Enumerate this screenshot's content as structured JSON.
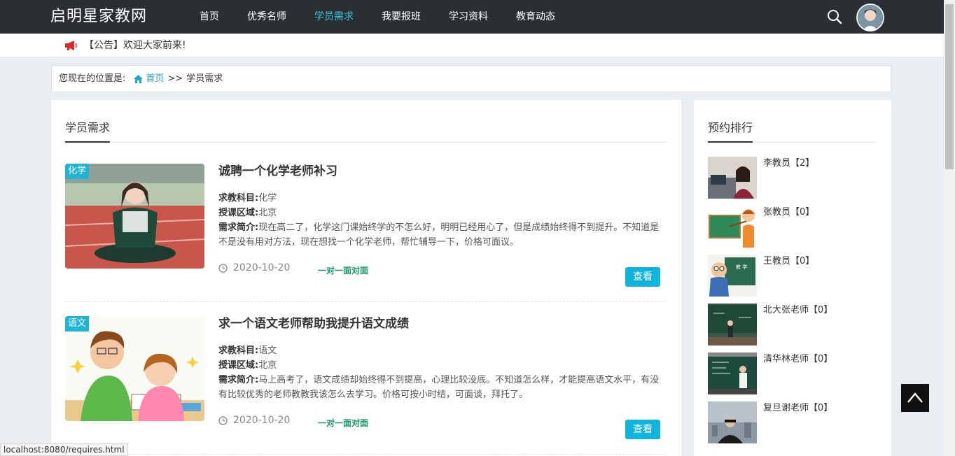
{
  "header": {
    "logo": "启明星家教网",
    "nav": [
      {
        "label": "首页",
        "active": false
      },
      {
        "label": "优秀名师",
        "active": false
      },
      {
        "label": "学员需求",
        "active": true
      },
      {
        "label": "我要报班",
        "active": false
      },
      {
        "label": "学习资料",
        "active": false
      },
      {
        "label": "教育动态",
        "active": false
      }
    ]
  },
  "notice": {
    "text": "【公告】欢迎大家前来!"
  },
  "breadcrumb": {
    "prefix": "您现在的位置是:",
    "home": "首页",
    "separator": ">>",
    "current": "学员需求"
  },
  "main": {
    "section_title": "学员需求",
    "requests": [
      {
        "tag": "化学",
        "title": "诚聘一个化学老师补习",
        "subject_label": "求教科目:",
        "subject": "化学",
        "area_label": "授课区域:",
        "area": "北京",
        "intro_label": "需求简介:",
        "intro": "现在高二了，化学这门课始终学的不怎么好，明明已经用心了，但是成绩始终得不到提升。不知道是不是没有用对方法，现在想找一个化学老师，帮忙辅导一下，价格可面议。",
        "date": "2020-10-20",
        "mode": "一对一面对面",
        "button": "查看"
      },
      {
        "tag": "语文",
        "title": "求一个语文老师帮助我提升语文成绩",
        "subject_label": "求教科目:",
        "subject": "语文",
        "area_label": "授课区域:",
        "area": "北京",
        "intro_label": "需求简介:",
        "intro": "马上高考了，语文成绩却始终得不到提高，心理比较没底。不知道怎么样，才能提高语文水平，有没有比较优秀的老师教教我该怎么去学习。价格可按小时结，可面谈，拜托了。",
        "date": "2020-10-20",
        "mode": "一对一面对面",
        "button": "查看"
      }
    ]
  },
  "sidebar": {
    "title": "预约排行",
    "ranks": [
      {
        "name": "李教员【2】"
      },
      {
        "name": "张教员【0】"
      },
      {
        "name": "王教员【0】"
      },
      {
        "name": "北大张老师【0】"
      },
      {
        "name": "清华林老师【0】"
      },
      {
        "name": "复旦谢老师【0】"
      }
    ]
  },
  "status_url": "localhost:8080/requires.html",
  "colors": {
    "accent": "#37c6e0",
    "header_bg": "#2b2f33",
    "button": "#11b5db",
    "mode_text": "#159a6a"
  }
}
